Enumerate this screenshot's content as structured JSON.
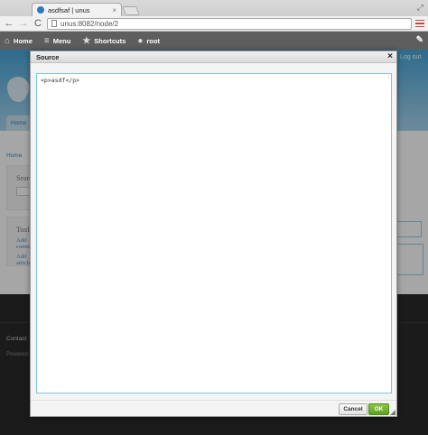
{
  "browser": {
    "tab_title": "asdfsaf | unus",
    "tab_close": "×",
    "url": "unus:8082/node/2",
    "back": "←",
    "forward": "→",
    "reload": "C",
    "expand": "⤢"
  },
  "drupal_toolbar": {
    "home_label": "Home",
    "menu_label": "Menu",
    "shortcuts_label": "Shortcuts",
    "user_label": "root",
    "icons": {
      "home": "⌂",
      "menu": "≡",
      "shortcuts": "★",
      "user": "●",
      "edit": "✎"
    }
  },
  "page": {
    "logout": "Log out",
    "home_tab": "Home",
    "breadcrumb": "Home",
    "search_title": "Search",
    "tools_title": "Tools",
    "tools_links": [
      "Add content",
      "Add article"
    ],
    "footer_contact": "Contact",
    "footer_powered": "Powered by Drupal"
  },
  "dialog": {
    "title": "Source",
    "close": "×",
    "source_text": "<p>asdf</p>",
    "cancel_label": "Cancel",
    "ok_label": "OK",
    "colors": {
      "ok_green": "#6ab12e",
      "editor_border": "#7cc4e2"
    }
  }
}
